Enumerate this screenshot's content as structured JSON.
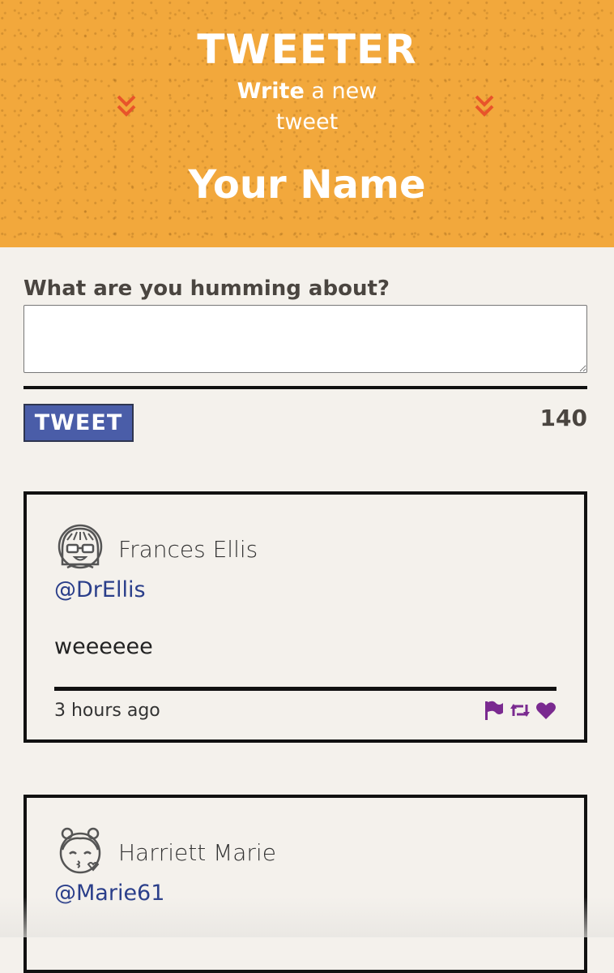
{
  "header": {
    "logo": "TWEETER",
    "compose_toggle": {
      "strong": "Write",
      "rest": " a new tweet"
    },
    "user_name": "Your Name"
  },
  "compose": {
    "label": "What are you humming about?",
    "input_value": "",
    "button_label": "TWEET",
    "counter": "140"
  },
  "tweets": [
    {
      "name": "Frances Ellis",
      "handle": "@DrEllis",
      "text": "weeeeee",
      "time": "3 hours ago"
    },
    {
      "name": "Harriett Marie",
      "handle": "@Marie61"
    }
  ],
  "colors": {
    "header_bg": "#f2a83c",
    "chevron": "#e8542a",
    "button_bg": "#4a5da8",
    "handle": "#2a3e8a",
    "action_icons": "#7a2a90"
  }
}
